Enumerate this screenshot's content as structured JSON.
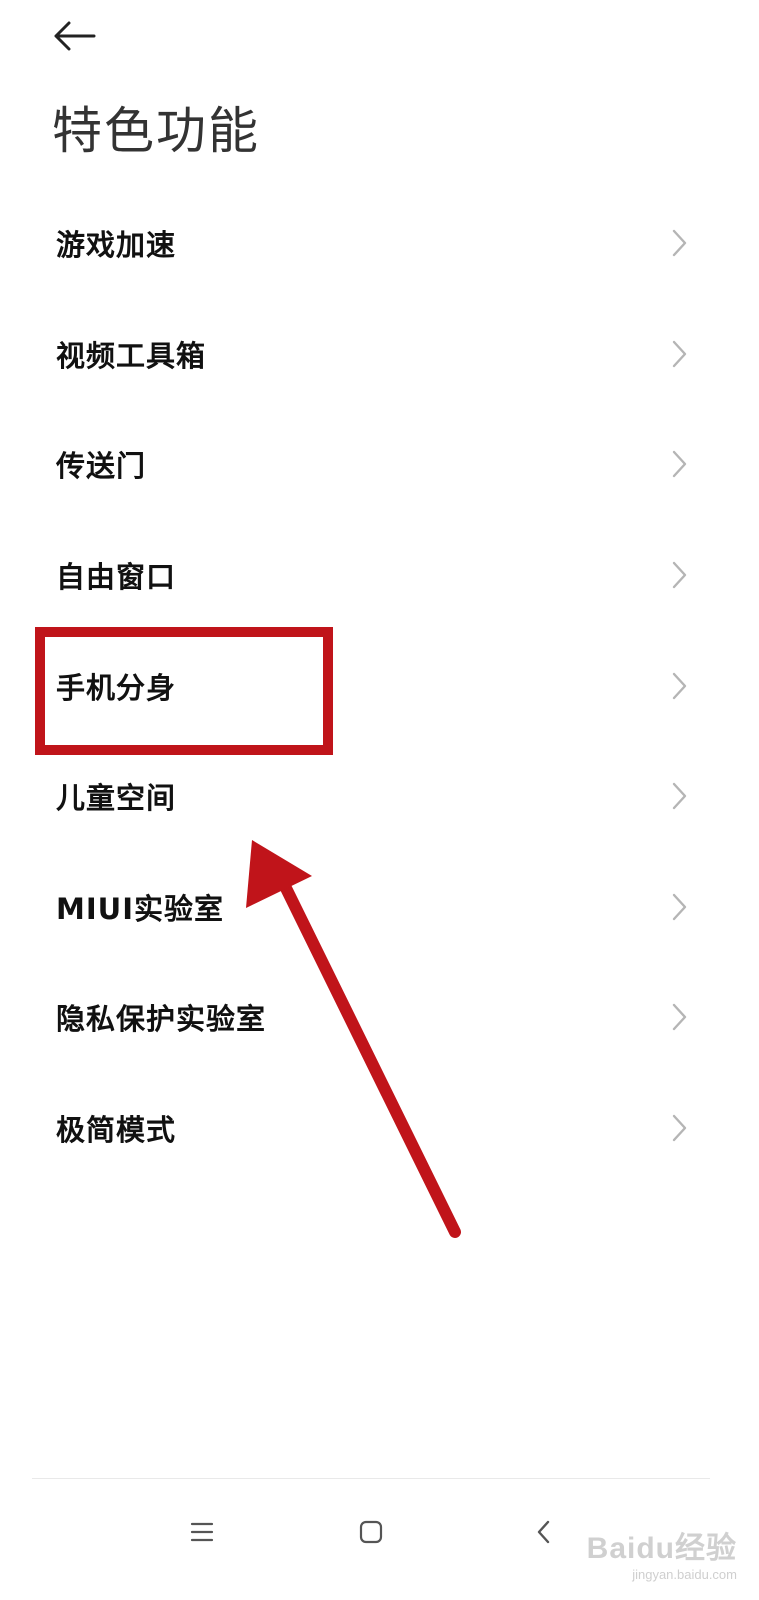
{
  "header": {
    "back_icon": "arrow-left-icon",
    "title": "特色功能"
  },
  "menu": {
    "items": [
      {
        "label": "游戏加速",
        "icon": "chevron-right-icon"
      },
      {
        "label": "视频工具箱",
        "icon": "chevron-right-icon"
      },
      {
        "label": "传送门",
        "icon": "chevron-right-icon"
      },
      {
        "label": "自由窗口",
        "icon": "chevron-right-icon"
      },
      {
        "label": "手机分身",
        "icon": "chevron-right-icon",
        "highlighted": true
      },
      {
        "label": "儿童空间",
        "icon": "chevron-right-icon"
      },
      {
        "label": "MIUI实验室",
        "icon": "chevron-right-icon"
      },
      {
        "label": "隐私保护实验室",
        "icon": "chevron-right-icon"
      },
      {
        "label": "极简模式",
        "icon": "chevron-right-icon"
      }
    ]
  },
  "annotation": {
    "highlight_color": "#c0141a",
    "arrow_color": "#c0141a"
  },
  "nav_bar": {
    "buttons": [
      "menu-icon",
      "home-square-icon",
      "back-chevron-icon"
    ]
  },
  "watermark": {
    "brand": "Baidu经验",
    "url": "jingyan.baidu.com"
  }
}
